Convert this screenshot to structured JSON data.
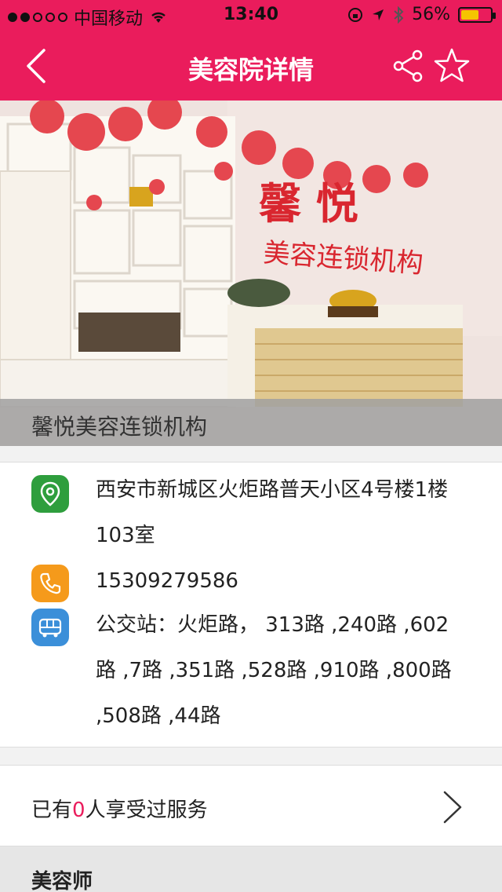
{
  "status": {
    "carrier": "中国移动",
    "time": "13:40",
    "battery": "56%"
  },
  "nav": {
    "title": "美容院详情"
  },
  "hero": {
    "caption": "馨悦美容连锁机构",
    "wall_title": "馨  悦",
    "wall_subtitle": "美容连锁机构"
  },
  "info": {
    "address_line1": "西安市新城区火炬路普天小区4号楼1楼",
    "address_line2": "103室",
    "phone": "15309279586",
    "bus_line1": "公交站：火炬路，  313路 ,240路 ,602",
    "bus_line2": "路 ,7路 ,351路 ,528路 ,910路 ,800路",
    "bus_line3": ",508路 ,44路"
  },
  "service": {
    "prefix": "已有",
    "count": "0",
    "suffix": "人享受过服务"
  },
  "section": {
    "beautician_title": "美容师"
  },
  "colors": {
    "brand": "#ea1c5c",
    "map_icon": "#2e9e3d",
    "phone_icon": "#f59a1b",
    "bus_icon": "#3b8fd9"
  },
  "icons": {
    "back": "chevron-left-icon",
    "share": "share-icon",
    "favorite": "star-icon",
    "location": "location-pin-icon",
    "phone": "phone-icon",
    "bus": "bus-icon",
    "service_arrow": "chevron-right-icon"
  }
}
